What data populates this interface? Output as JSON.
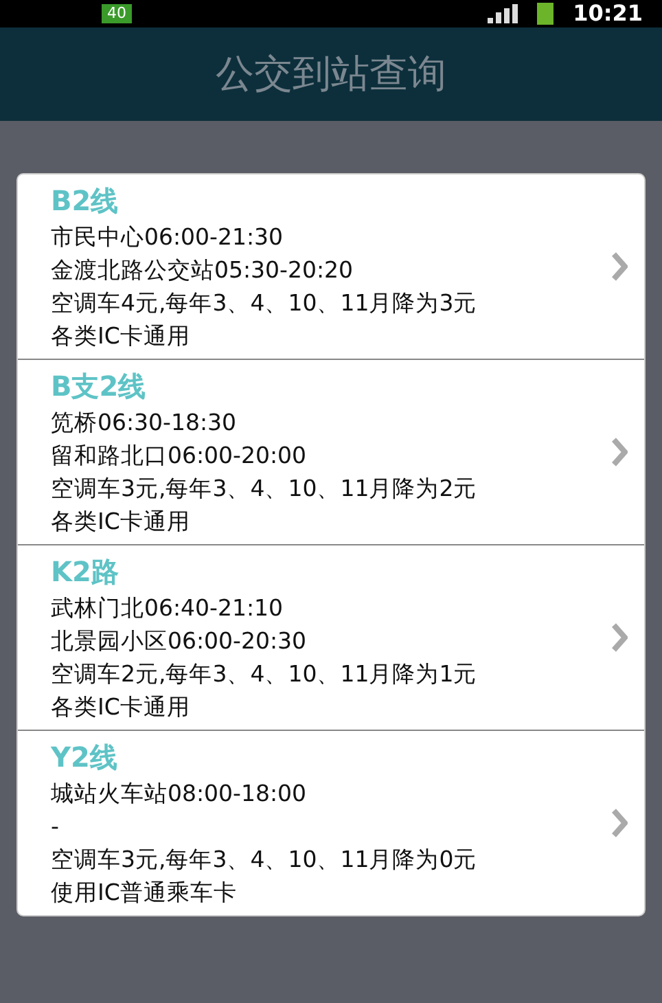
{
  "status_bar": {
    "time": "10:21",
    "battery_text": "40"
  },
  "header": {
    "title": "公交到站查询"
  },
  "routes": [
    {
      "name": "B2线",
      "lines": [
        "市民中心06:00-21:30",
        "金渡北路公交站05:30-20:20",
        "空调车4元,每年3、4、10、11月降为3元",
        "各类IC卡通用"
      ]
    },
    {
      "name": "B支2线",
      "lines": [
        "笕桥06:30-18:30",
        "留和路北口06:00-20:00",
        "空调车3元,每年3、4、10、11月降为2元",
        "各类IC卡通用"
      ]
    },
    {
      "name": "K2路",
      "lines": [
        "武林门北06:40-21:10",
        "北景园小区06:00-20:30",
        "空调车2元,每年3、4、10、11月降为1元",
        "各类IC卡通用"
      ]
    },
    {
      "name": "Y2线",
      "lines": [
        "城站火车站08:00-18:00",
        "-",
        "空调车3元,每年3、4、10、11月降为0元",
        "使用IC普通乘车卡"
      ]
    }
  ]
}
